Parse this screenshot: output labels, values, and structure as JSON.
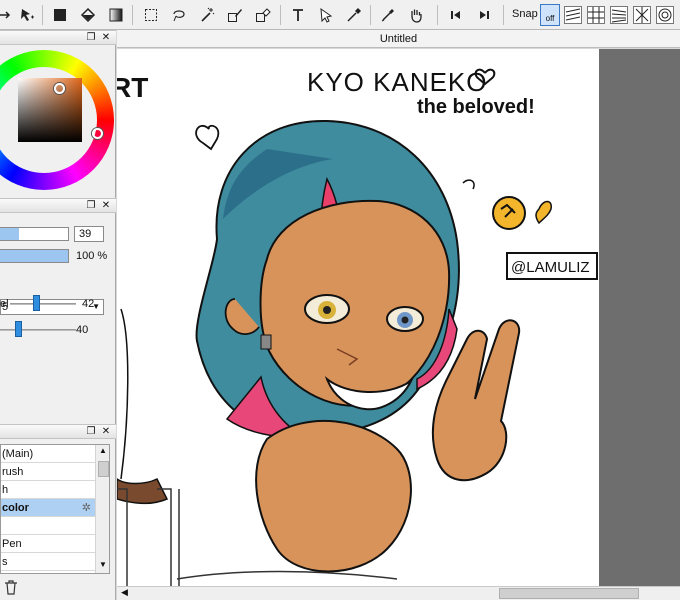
{
  "toolbar": {
    "snap_label": "Snap",
    "snap_state": "off",
    "tools": [
      "hand-select-icon",
      "move-icon",
      "fill-rect-icon",
      "bucket-icon",
      "gradient-icon",
      "rect-select-icon",
      "lasso-icon",
      "magic-wand-icon",
      "select-pen-icon",
      "select-eraser-icon",
      "text-icon",
      "pointer-icon",
      "eyedropper-icon",
      "pipette-icon",
      "hand-icon",
      "prev-icon",
      "next-icon"
    ]
  },
  "document": {
    "title": "Untitled"
  },
  "color_panel": {
    "hue_accent": "#e0671a"
  },
  "brush_settings": {
    "size_value": "39",
    "density_value": "100 %",
    "brush_shape": "5",
    "slider1_label": "el",
    "slider1_value": "42",
    "slider2_value": "40"
  },
  "brush_list": {
    "items": [
      {
        "label": "(Main)",
        "selected": false
      },
      {
        "label": "rush",
        "selected": false
      },
      {
        "label": "h",
        "selected": false
      },
      {
        "label": "color",
        "selected": true
      },
      {
        "label": "",
        "selected": false
      },
      {
        "label": "Pen",
        "selected": false
      },
      {
        "label": "s",
        "selected": false
      }
    ]
  },
  "artwork": {
    "title": "KYO KANEKO",
    "subtitle": "the beloved!",
    "signature": "@LAMULIZ",
    "partial_text": "RT"
  }
}
